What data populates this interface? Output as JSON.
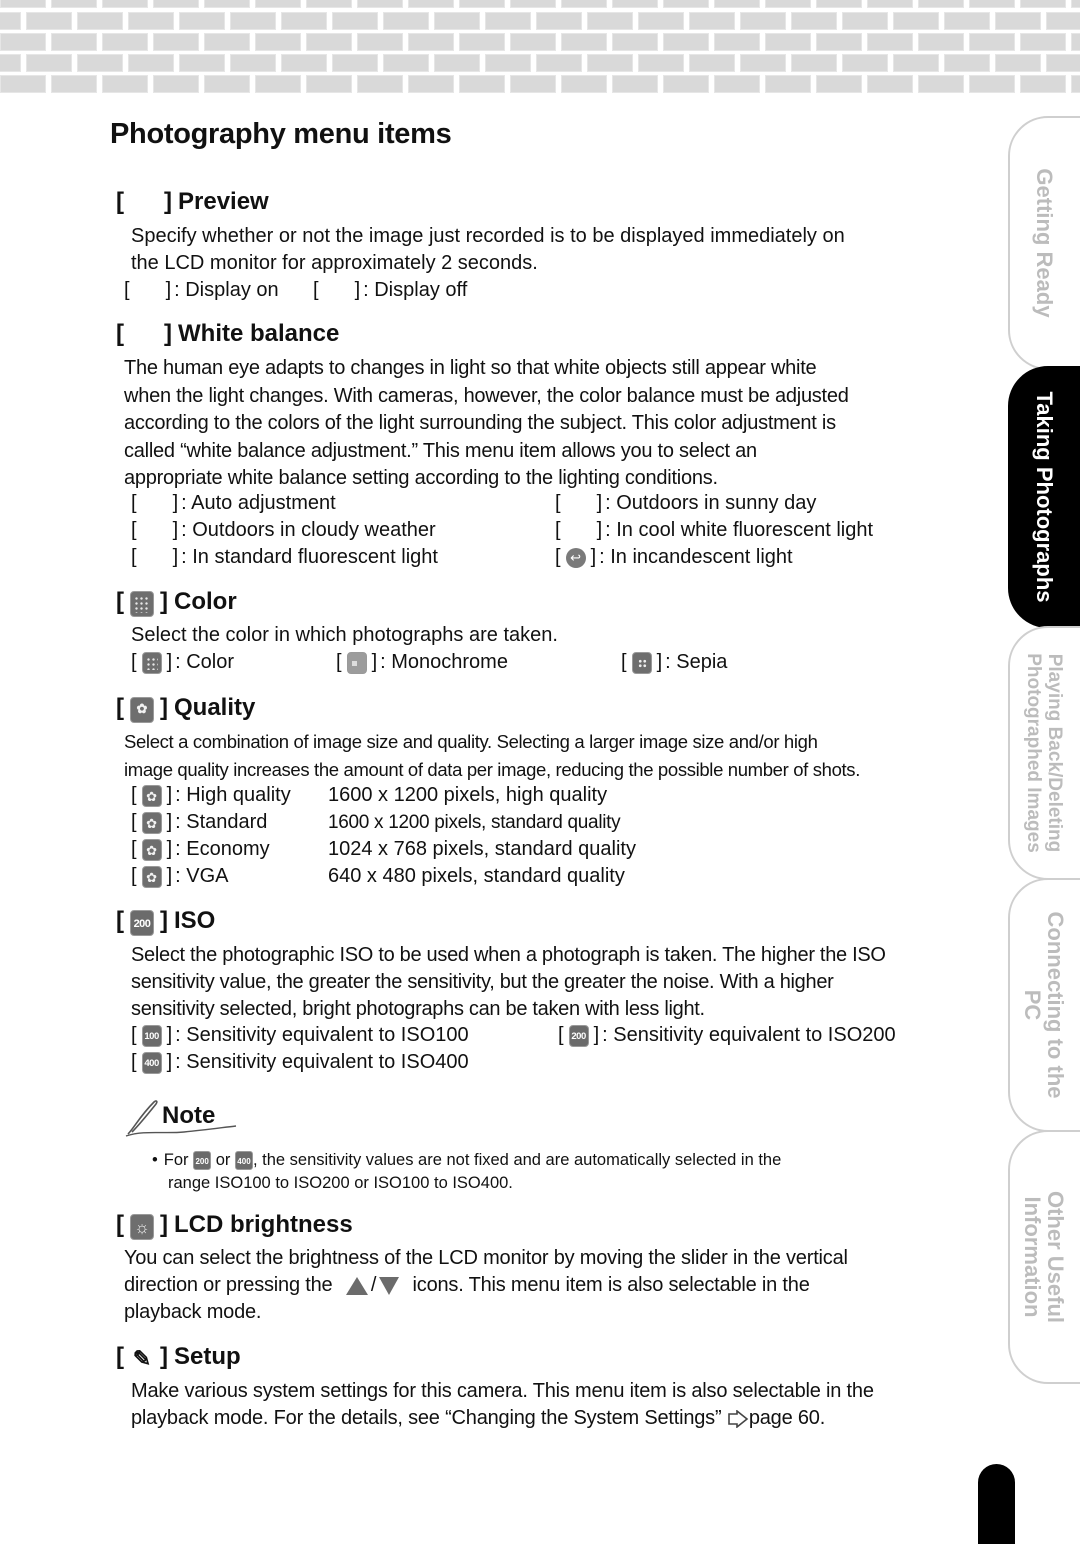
{
  "page": {
    "title": "Photography menu items"
  },
  "sections": {
    "preview": {
      "heading": "Preview",
      "icon": "preview-icon",
      "body": [
        "Specify whether or not the image just recorded is to be displayed immediately on",
        "the LCD monitor for approximately 2 seconds."
      ],
      "options": [
        {
          "icon": "display-on-icon",
          "label": ": Display on"
        },
        {
          "icon": "display-off-icon",
          "label": ": Display off"
        }
      ]
    },
    "white_balance": {
      "heading": "White balance",
      "icon": "white-balance-icon",
      "body": [
        "The human eye adapts to changes in light so that white objects still appear white",
        "when the light changes. With cameras, however, the color balance must be adjusted",
        "according to the colors of the light surrounding the subject. This color adjustment is",
        "called “white balance adjustment.” This menu item allows you to select an",
        "appropriate white balance setting according to the lighting conditions."
      ],
      "options": [
        {
          "icon": "auto-wb-icon",
          "label": ": Auto adjustment"
        },
        {
          "icon": "sunny-icon",
          "label": ": Outdoors in sunny day"
        },
        {
          "icon": "cloudy-icon",
          "label": ": Outdoors in cloudy weather"
        },
        {
          "icon": "cool-fluorescent-icon",
          "label": ": In cool white fluorescent light"
        },
        {
          "icon": "standard-fluorescent-icon",
          "label": ": In standard fluorescent light"
        },
        {
          "icon": "incandescent-icon",
          "label": ": In incandescent light"
        }
      ]
    },
    "color": {
      "heading": "Color",
      "icon": "color-icon",
      "body": "Select the color in which photographs are taken.",
      "options": [
        {
          "icon": "color-mode-icon",
          "label": ": Color"
        },
        {
          "icon": "monochrome-icon",
          "label": ": Monochrome"
        },
        {
          "icon": "sepia-icon",
          "label": ": Sepia"
        }
      ]
    },
    "quality": {
      "heading": "Quality",
      "icon": "quality-icon",
      "body": [
        "Select a combination of image size and quality. Selecting a larger image size and/or high",
        "image quality increases the amount of data per image, reducing the possible number of shots."
      ],
      "options": [
        {
          "icon": "high-quality-icon",
          "label": ": High quality",
          "desc": "1600 x 1200 pixels, high quality"
        },
        {
          "icon": "standard-quality-icon",
          "label": ": Standard",
          "desc": "1600 x 1200 pixels, standard quality"
        },
        {
          "icon": "economy-quality-icon",
          "label": ": Economy",
          "desc": "1024 x 768 pixels, standard quality"
        },
        {
          "icon": "vga-quality-icon",
          "label": ": VGA",
          "desc": "640 x 480 pixels, standard quality"
        }
      ]
    },
    "iso": {
      "heading": "ISO",
      "icon_text": "200",
      "body": [
        "Select the photographic ISO to be used when a photograph is taken. The higher the ISO",
        "sensitivity value, the greater the sensitivity, but the greater the noise. With a higher",
        "sensitivity selected, bright photographs can be taken with less light."
      ],
      "options": [
        {
          "icon_text": "100",
          "label": ": Sensitivity equivalent to ISO100"
        },
        {
          "icon_text": "200",
          "label": ": Sensitivity equivalent to ISO200"
        },
        {
          "icon_text": "400",
          "label": ": Sensitivity equivalent to ISO400"
        }
      ]
    },
    "note": {
      "heading": "Note",
      "bullet": "•",
      "text_for": "For",
      "icon_a": "200",
      "text_or": "or",
      "icon_b": "400",
      "text_rest": ", the sensitivity values are not fixed and are automatically selected in the",
      "text_line2": "range ISO100 to ISO200 or ISO100 to ISO400."
    },
    "lcd_brightness": {
      "heading": "LCD brightness",
      "icon": "brightness-icon",
      "line1": "You can select the brightness of the LCD monitor by moving the slider in the vertical",
      "line2_pre": "direction or pressing the",
      "line2_sep": "/",
      "line2_post": "icons. This menu item is also selectable in the",
      "line3": "playback mode."
    },
    "setup": {
      "heading": "Setup",
      "icon": "wrench-icon",
      "line1": "Make various system settings for this camera. This menu item is also selectable in the",
      "line2_pre": "playback mode. For the details, see “Changing the System Settings”",
      "line2_post": "page 60."
    }
  },
  "bracket_open": "[",
  "bracket_close": "]",
  "side_tabs": [
    {
      "label": "Getting Ready",
      "active": false
    },
    {
      "label": "Taking Photographs",
      "active": true
    },
    {
      "label_line1": "Playing Back/Deleting",
      "label_line2": "Photographed Images",
      "active": false
    },
    {
      "label_line1": "Connecting to the",
      "label_line2": "PC",
      "active": false
    },
    {
      "label_line1": "Other Useful",
      "label_line2": "Information",
      "active": false
    }
  ],
  "colors": {
    "brick": "#d9d9d9",
    "tab_border": "#cfcfcf",
    "tab_text": "#bcbcbc",
    "active_tab": "#000000",
    "icon_gray": "#6e6e6e"
  }
}
